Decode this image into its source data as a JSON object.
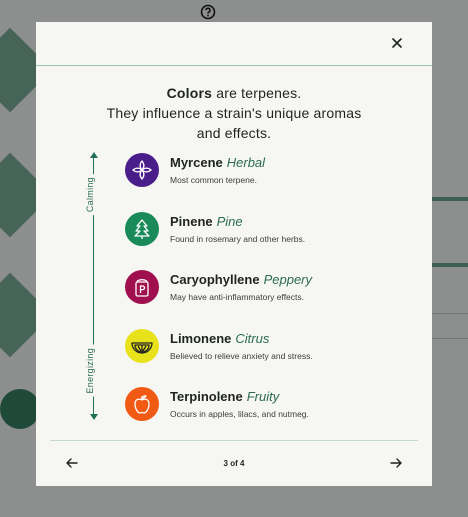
{
  "intro": {
    "line1_bold": "Colors",
    "line1_rest": " are terpenes.",
    "line2": "They influence a strain's unique aromas",
    "line3": "and effects."
  },
  "scale": {
    "top_label": "Calming",
    "bottom_label": "Energizing"
  },
  "terpenes": [
    {
      "name": "Myrcene",
      "aroma": "Herbal",
      "desc": "Most common terpene.",
      "color": "#4a1e8a",
      "icon": "flower-icon"
    },
    {
      "name": "Pinene",
      "aroma": "Pine",
      "desc": "Found in rosemary and other herbs.",
      "color": "#1a8a5a",
      "icon": "pine-tree-icon"
    },
    {
      "name": "Caryophyllene",
      "aroma": "Peppery",
      "desc": "May have anti-inflammatory effects.",
      "color": "#a0104e",
      "icon": "pepper-shaker-icon"
    },
    {
      "name": "Limonene",
      "aroma": "Citrus",
      "desc": "Believed to relieve anxiety and stress.",
      "color": "#e8e21a",
      "icon": "citrus-slice-icon"
    },
    {
      "name": "Terpinolene",
      "aroma": "Fruity",
      "desc": "Occurs in apples, lilacs, and nutmeg.",
      "color": "#f05a14",
      "icon": "apple-icon"
    }
  ],
  "footer": {
    "pager": "3 of 4"
  },
  "colors": {
    "accent": "#23705a",
    "modal_bg": "#f6f6f3",
    "overlay": "#8d8f8e"
  }
}
